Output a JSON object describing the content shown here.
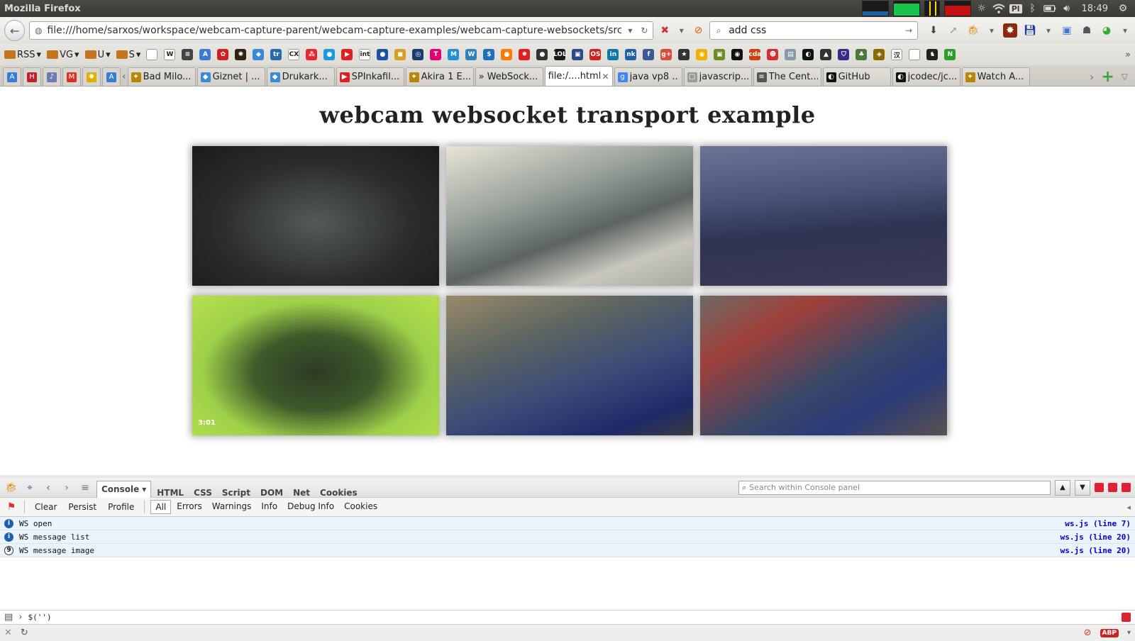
{
  "system": {
    "app_title": "Mozilla Firefox",
    "keyboard_layout": "Pl",
    "clock": "18:49"
  },
  "nav": {
    "url": "file:///home/sarxos/workspace/webcam-capture-parent/webcam-capture-examples/webcam-capture-websockets/src/main/html/in",
    "search_value": "add css"
  },
  "bookmarks": {
    "folders": [
      "RSS",
      "VG",
      "U",
      "S"
    ],
    "icons": [
      {
        "name": "page",
        "color": "#ffffff",
        "glyph": ""
      },
      {
        "name": "wikipedia",
        "color": "#ffffff",
        "glyph": "W"
      },
      {
        "name": "list",
        "color": "#444444",
        "glyph": "≡"
      },
      {
        "name": "translate",
        "color": "#3a7bd5",
        "glyph": "A"
      },
      {
        "name": "rss-red",
        "color": "#d02020",
        "glyph": "✿"
      },
      {
        "name": "dark-orange",
        "color": "#332211",
        "glyph": "✺"
      },
      {
        "name": "blue-diamond",
        "color": "#3a8ad6",
        "glyph": "◆"
      },
      {
        "name": "trello",
        "color": "#2b6aa8",
        "glyph": "tr"
      },
      {
        "name": "cx",
        "color": "#ffffff",
        "glyph": "CX"
      },
      {
        "name": "dots",
        "color": "#e8262e",
        "glyph": "⁂"
      },
      {
        "name": "blue-bird",
        "color": "#1c9ae0",
        "glyph": "●"
      },
      {
        "name": "youtube",
        "color": "#e02020",
        "glyph": "▶"
      },
      {
        "name": "int",
        "color": "#ffffff",
        "glyph": "int"
      },
      {
        "name": "blue-circle",
        "color": "#2050a0",
        "glyph": "●"
      },
      {
        "name": "yellow-box",
        "color": "#d8a020",
        "glyph": "◼"
      },
      {
        "name": "target",
        "color": "#1a3d6e",
        "glyph": "◎"
      },
      {
        "name": "t-mobile",
        "color": "#e20074",
        "glyph": "T"
      },
      {
        "name": "m",
        "color": "#1e90d6",
        "glyph": "M"
      },
      {
        "name": "wordpress",
        "color": "#2e82c0",
        "glyph": "W"
      },
      {
        "name": "s-circle",
        "color": "#1f6fbf",
        "glyph": "$"
      },
      {
        "name": "orange-circle",
        "color": "#ff7a00",
        "glyph": "●"
      },
      {
        "name": "red-burst",
        "color": "#e02020",
        "glyph": "✹"
      },
      {
        "name": "dark-circle",
        "color": "#333333",
        "glyph": "●"
      },
      {
        "name": "lol",
        "color": "#1a1a1a",
        "glyph": "LOL"
      },
      {
        "name": "photo",
        "color": "#2a4a8a",
        "glyph": "▣"
      },
      {
        "name": "os",
        "color": "#d02020",
        "glyph": "OS"
      },
      {
        "name": "linkedin",
        "color": "#0e76a8",
        "glyph": "in"
      },
      {
        "name": "nk",
        "color": "#2060a8",
        "glyph": "nk"
      },
      {
        "name": "facebook",
        "color": "#3b5998",
        "glyph": "f"
      },
      {
        "name": "google-plus",
        "color": "#dd4b39",
        "glyph": "g+"
      },
      {
        "name": "star",
        "color": "#333333",
        "glyph": "★"
      },
      {
        "name": "yellow-ring",
        "color": "#f0b000",
        "glyph": "◉"
      },
      {
        "name": "green-box",
        "color": "#6b8e23",
        "glyph": "▣"
      },
      {
        "name": "gold-ring",
        "color": "#111111",
        "glyph": "◉"
      },
      {
        "name": "cda",
        "color": "#d04010",
        "glyph": "cda"
      },
      {
        "name": "red-face",
        "color": "#d03030",
        "glyph": "☻"
      },
      {
        "name": "docs",
        "color": "#8899aa",
        "glyph": "▤"
      },
      {
        "name": "github",
        "color": "#111111",
        "glyph": "◐"
      },
      {
        "name": "house",
        "color": "#333333",
        "glyph": "▲"
      },
      {
        "name": "shield",
        "color": "#3a2a8a",
        "glyph": "⛉"
      },
      {
        "name": "tree",
        "color": "#4a7a3a",
        "glyph": "♣"
      },
      {
        "name": "key",
        "color": "#8a6a00",
        "glyph": "◈"
      },
      {
        "name": "kanji",
        "color": "#ffffff",
        "glyph": "汉"
      },
      {
        "name": "page2",
        "color": "#ffffff",
        "glyph": ""
      },
      {
        "name": "monkey",
        "color": "#222222",
        "glyph": "♞"
      },
      {
        "name": "n-green",
        "color": "#2aa02a",
        "glyph": "N"
      }
    ]
  },
  "tabs": {
    "pinned": [
      {
        "name": "translate",
        "color": "#3a7bd5",
        "glyph": "A"
      },
      {
        "name": "h-red",
        "color": "#c0202a",
        "glyph": "H"
      },
      {
        "name": "music",
        "color": "#6c7bb0",
        "glyph": "♪"
      },
      {
        "name": "gmail",
        "color": "#d93025",
        "glyph": "M"
      },
      {
        "name": "bulb",
        "color": "#e0b000",
        "glyph": "✹"
      },
      {
        "name": "translate2",
        "color": "#3a7bd5",
        "glyph": "A"
      }
    ],
    "items": [
      {
        "label": "Bad Milo...",
        "color": "#b8860b",
        "glyph": "✦",
        "active": false
      },
      {
        "label": "Giznet | ...",
        "color": "#3a8ad6",
        "glyph": "◆",
        "active": false
      },
      {
        "label": "Drukark...",
        "color": "#3a8ad6",
        "glyph": "◆",
        "active": false
      },
      {
        "label": "SPInkafil...",
        "color": "#e02020",
        "glyph": "▶",
        "active": false
      },
      {
        "label": "Akira 1 E...",
        "color": "#b8860b",
        "glyph": "✦",
        "active": false
      },
      {
        "label": "» WebSock...",
        "color": "#ffffff",
        "glyph": "",
        "active": false
      },
      {
        "label": "file:/....html",
        "color": "#ffffff",
        "glyph": "",
        "active": true
      },
      {
        "label": "java vp8 ...",
        "color": "#4285f4",
        "glyph": "g",
        "active": false
      },
      {
        "label": "javascrip...",
        "color": "#999999",
        "glyph": "▢",
        "active": false
      },
      {
        "label": "The Cent...",
        "color": "#555555",
        "glyph": "≡",
        "active": false
      },
      {
        "label": "GitHub",
        "color": "#111111",
        "glyph": "◐",
        "active": false
      },
      {
        "label": "jcodec/jc...",
        "color": "#111111",
        "glyph": "◐",
        "active": false
      },
      {
        "label": "Watch A...",
        "color": "#b8860b",
        "glyph": "✦",
        "active": false
      }
    ]
  },
  "page": {
    "title": "webcam websocket transport example",
    "cameras": [
      {
        "name": "office-dark",
        "bg": "radial-gradient(ellipse at 50% 55%, #555a57 0%, #2a2d2c 55%, #1a1c1b 100%)"
      },
      {
        "name": "newsroom-desk",
        "bg": "linear-gradient(160deg, #e8e4d6 0%, #9aa39c 35%, #5c6460 60%, #c8c6be 80%, #a9aaa2 100%)"
      },
      {
        "name": "office-wide",
        "bg": "linear-gradient(175deg, #6b7596 0%, #4a5478 35%, #2e3452 60%, #3c3a58 100%)"
      },
      {
        "name": "garden-sign",
        "bg": "radial-gradient(ellipse at 50% 55%, #2d3a24 0%, #3e5a2a 35%, #9ed14a 65%, #b6e04a 100%)"
      },
      {
        "name": "radio-studio-1",
        "bg": "linear-gradient(160deg, #9a8a6a 0%, #5e6660 30%, #3b4a78 60%, #1e2a68 85%, #3a3a40 100%)"
      },
      {
        "name": "radio-studio-2",
        "bg": "linear-gradient(150deg, #6e6a66 0%, #a0403a 25%, #3a4868 55%, #2a3a78 75%, #5a5250 100%)"
      }
    ],
    "cam_timestamp": "3:01"
  },
  "firebug": {
    "tabs": [
      "Console",
      "HTML",
      "CSS",
      "Script",
      "DOM",
      "Net",
      "Cookies"
    ],
    "active_tab": "Console",
    "search_placeholder": "Search within Console panel",
    "toolbar_buttons": [
      "Clear",
      "Persist",
      "Profile"
    ],
    "filters": [
      "All",
      "Errors",
      "Warnings",
      "Info",
      "Debug Info",
      "Cookies"
    ],
    "active_filter": "All",
    "log": [
      {
        "icon": "i",
        "message": "WS open",
        "source": "ws.js (line 7)"
      },
      {
        "icon": "i",
        "message": "WS message list",
        "source": "ws.js (line 20)"
      },
      {
        "icon": "9",
        "message": "WS message image",
        "source": "ws.js (line 20)"
      }
    ],
    "command": "$('')"
  },
  "colors": {
    "link": "#0000cc",
    "info_icon": "#1d5fb0",
    "log_row_bg": "#ebf3fb"
  }
}
